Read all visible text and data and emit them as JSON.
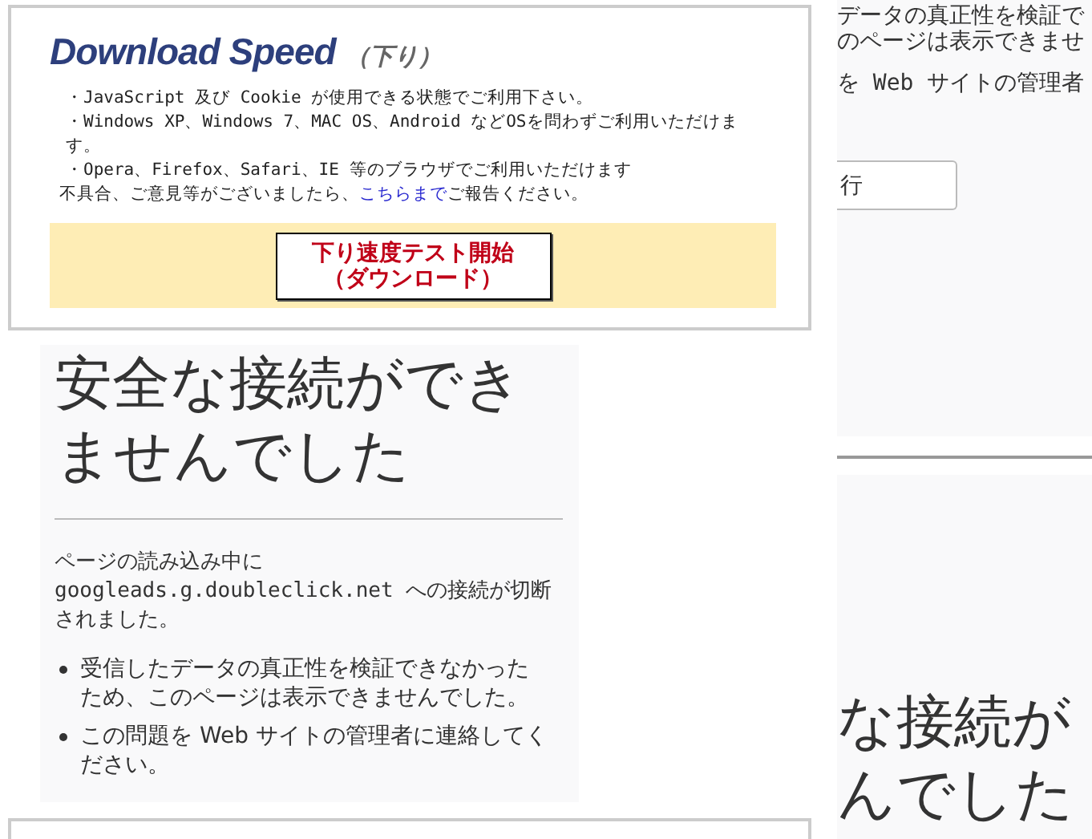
{
  "speed_panel": {
    "title": "Download Speed",
    "subtitle": "（下り）",
    "notes": [
      "・JavaScript 及び Cookie が使用できる状態でご利用下さい。",
      "・Windows XP、Windows 7、MAC OS、Android などOSを問わずご利用いただけます。",
      "・Opera、Firefox、Safari、IE 等のブラウザでご利用いただけます"
    ],
    "feedback": {
      "before": "不具合、ご意見等がございましたら、",
      "link": "こちらまで",
      "after": "ご報告ください。"
    },
    "start_button": [
      "下り速度テスト開始",
      "（ダウンロード）"
    ]
  },
  "error_panel": {
    "heading": "安全な接続ができませんでした",
    "message": "ページの読み込み中に googleads.g.doubleclick.net への接続が切断されました。",
    "bullets": [
      "受信したデータの真正性を検証できなかったため、このページは表示できませんでした。",
      "この問題を Web サイトの管理者に連絡してください。"
    ]
  },
  "right_panel": {
    "lines": [
      "データの真正性を検証で",
      "のページは表示できませ",
      "を Web サイトの管理者"
    ],
    "retry_button": "行",
    "heading_lines": [
      "な接続が",
      "んでした"
    ]
  }
}
